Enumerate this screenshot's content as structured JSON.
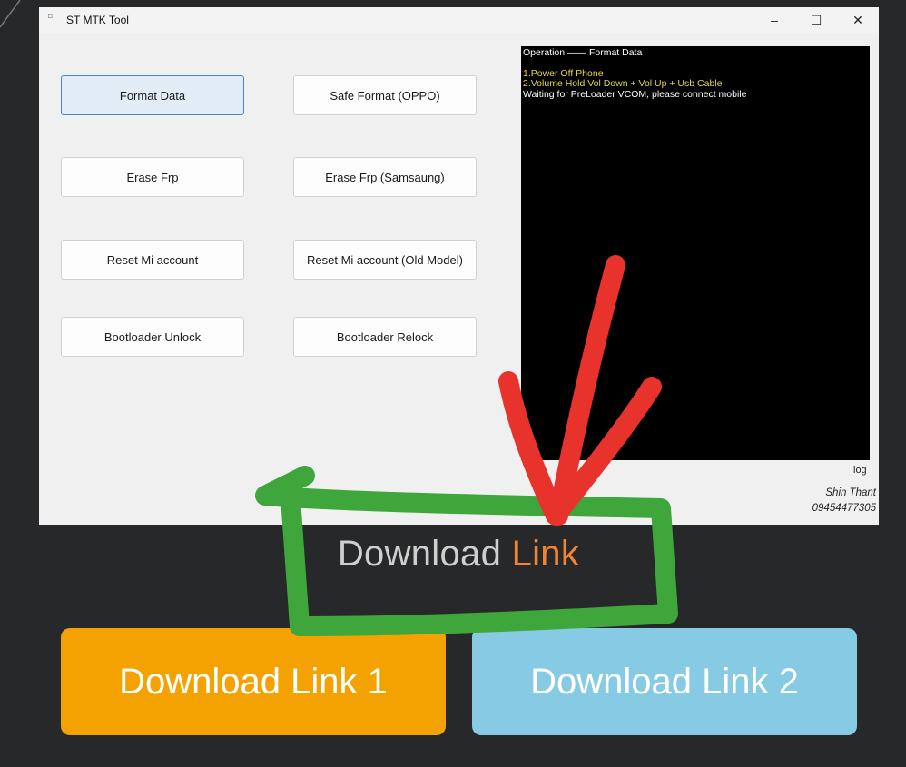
{
  "window": {
    "title": "ST MTK Tool",
    "icon": "app-icon",
    "controls": {
      "minimize": "–",
      "maximize": "☐",
      "close": "✕"
    }
  },
  "buttons": {
    "format_data": "Format Data",
    "safe_format_oppo": "Safe Format (OPPO)",
    "erase_frp": "Erase Frp",
    "erase_frp_samsung": "Erase Frp (Samsaung)",
    "reset_mi": "Reset Mi account",
    "reset_mi_old": "Reset Mi account (Old Model)",
    "bootloader_unlock": "Bootloader Unlock",
    "bootloader_relock": "Bootloader Relock"
  },
  "console": {
    "lines": [
      "Operation —— Format Data",
      "1.Power Off Phone",
      "2.Volume Hold Vol Down + Vol Up + Usb Cable",
      "Waiting for PreLoader VCOM, please connect mobile"
    ]
  },
  "log_label": "log",
  "author": {
    "name": "Shin Thant",
    "phone": "09454477305"
  },
  "download": {
    "heading_main": "Download",
    "heading_accent": "Link",
    "link1": "Download Link 1",
    "link2": "Download Link 2"
  },
  "colors": {
    "page_bg": "#262829",
    "accent_orange": "#f08433",
    "button1": "#f4a201",
    "button2": "#86cae3",
    "arrow_red": "#e8322c",
    "circle_green": "#3ea63b",
    "console_yellow": "#e8d44a"
  }
}
